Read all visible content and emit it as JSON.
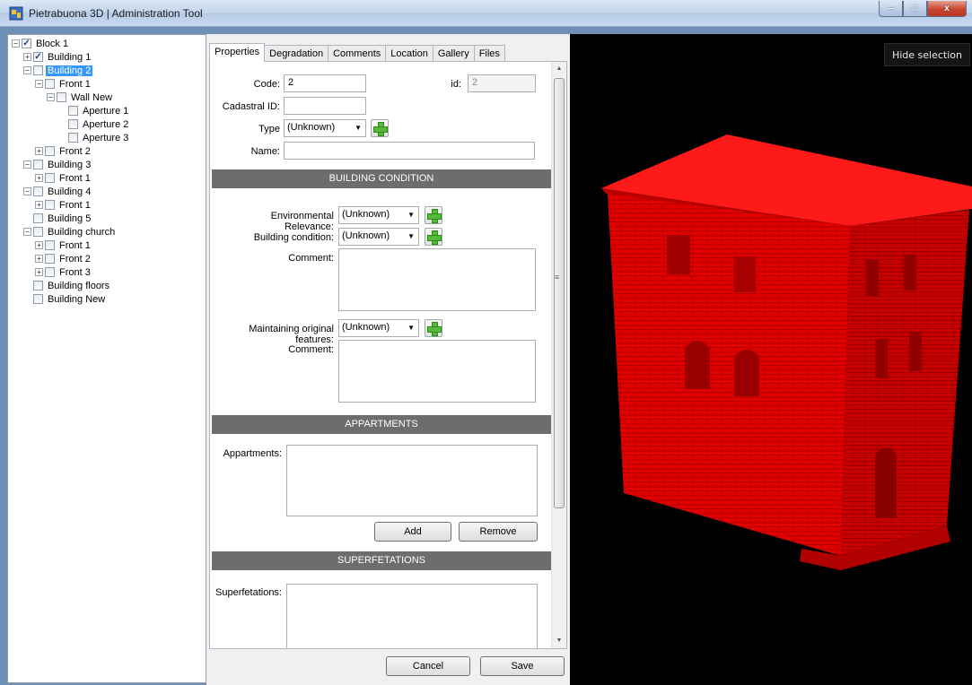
{
  "window": {
    "title": "Pietrabuona 3D | Administration Tool",
    "minimize": "–",
    "maximize": "□",
    "close": "x"
  },
  "tree": [
    {
      "label": "Block 1",
      "checked": true,
      "expander": "−"
    },
    {
      "label": "Building  1",
      "checked": true,
      "expander": "+"
    },
    {
      "label": "Building  2",
      "checked": false,
      "expander": "−",
      "selected": true
    },
    {
      "label": "Front  1",
      "checked": false,
      "expander": "−"
    },
    {
      "label": "Wall New",
      "checked": false,
      "expander": "−"
    },
    {
      "label": "Aperture 1",
      "checked": false,
      "expander": ""
    },
    {
      "label": "Aperture 2",
      "checked": false,
      "expander": ""
    },
    {
      "label": "Aperture 3",
      "checked": false,
      "expander": ""
    },
    {
      "label": "Front  2",
      "checked": false,
      "expander": "+"
    },
    {
      "label": "Building  3",
      "checked": false,
      "expander": "−"
    },
    {
      "label": "Front  1",
      "checked": false,
      "expander": "+"
    },
    {
      "label": "Building  4",
      "checked": false,
      "expander": "−"
    },
    {
      "label": "Front  1",
      "checked": false,
      "expander": "+"
    },
    {
      "label": "Building  5",
      "checked": false,
      "expander": ""
    },
    {
      "label": "Building  church",
      "checked": false,
      "expander": "−"
    },
    {
      "label": "Front  1",
      "checked": false,
      "expander": "+"
    },
    {
      "label": "Front  2",
      "checked": false,
      "expander": "+"
    },
    {
      "label": "Front  3",
      "checked": false,
      "expander": "+"
    },
    {
      "label": "Building  floors",
      "checked": false,
      "expander": ""
    },
    {
      "label": "Building  New",
      "checked": false,
      "expander": ""
    }
  ],
  "tabs": [
    "Properties",
    "Degradation",
    "Comments",
    "Location",
    "Gallery",
    "Files"
  ],
  "form": {
    "code_label": "Code:",
    "code_value": "2",
    "id_label": "id:",
    "id_value": "2",
    "cadastral_label": "Cadastral ID:",
    "cadastral_value": "",
    "type_label": "Type",
    "type_value": "(Unknown)",
    "name_label": "Name:",
    "name_value": "",
    "building_condition_header": "BUILDING CONDITION",
    "env_relevance_label": "Environmental Relevance:",
    "env_relevance_value": "(Unknown)",
    "building_condition_label": "Building condition:",
    "building_condition_value": "(Unknown)",
    "comment_label_1": "Comment:",
    "maintaining_label": "Maintaining original features:",
    "maintaining_value": "(Unknown)",
    "comment_label_2": "Comment:",
    "appartments_header": "APPARTMENTS",
    "appartments_label": "Appartments:",
    "add_label": "Add",
    "remove_label": "Remove",
    "superfetations_header": "SUPERFETATIONS",
    "superfetations_label": "Superfetations:"
  },
  "footer": {
    "cancel_label": "Cancel",
    "save_label": "Save"
  },
  "viewport": {
    "hide_selection_label": "Hide selection",
    "highlight_color": "#ff0000"
  }
}
